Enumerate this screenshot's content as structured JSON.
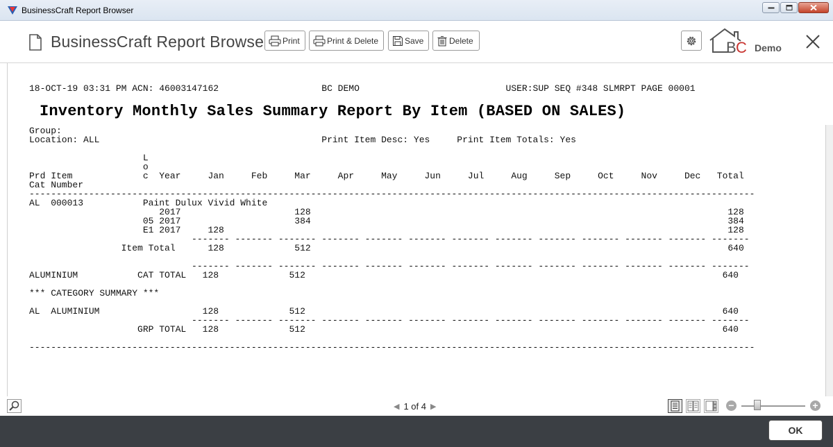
{
  "window": {
    "title": "BusinessCraft Report Browser"
  },
  "header": {
    "title": "BusinessCraft Report Browser",
    "buttons": {
      "print": "Print",
      "print_delete": "Print & Delete",
      "save": "Save",
      "delete": "Delete"
    },
    "logo_text": "BC",
    "demo_label": "Demo"
  },
  "report": {
    "header_line": "18-OCT-19 03:31 PM ACN: 46003147162                   BC DEMO                           USER:SUP SEQ #348 SLMRPT PAGE 00001",
    "title": "Inventory Monthly Sales Summary Report By Item (BASED ON SALES)",
    "lines": [
      "Group:",
      "Location: ALL                                         Print Item Desc: Yes     Print Item Totals: Yes",
      "",
      "                     L",
      "                     o",
      "Prd Item             c  Year     Jan     Feb     Mar     Apr     May     Jun     Jul     Aug     Sep     Oct     Nov     Dec   Total",
      "Cat Number",
      "--------------------------------------------------------------------------------------------------------------------------------------",
      "AL  000013           Paint Dulux Vivid White",
      "                        2017                     128                                                                             128",
      "                     05 2017                     384                                                                             384",
      "                     E1 2017     128                                                                                             128",
      "                              ------- ------- ------- ------- ------- ------- ------- ------- ------- ------- ------- ------- -------",
      "                 Item Total      128             512                                                                             640",
      "",
      "                              ------- ------- ------- ------- ------- ------- ------- ------- ------- ------- ------- ------- -------",
      "ALUMINIUM           CAT TOTAL   128             512                                                                             640",
      "",
      "*** CATEGORY SUMMARY ***",
      "",
      "AL  ALUMINIUM                   128             512                                                                             640",
      "                              ------- ------- ------- ------- ------- ------- ------- ------- ------- ------- ------- ------- -------",
      "                    GRP TOTAL   128             512                                                                             640",
      "",
      "--------------------------------------------------------------------------------------------------------------------------------------"
    ]
  },
  "pager": {
    "text": "1 of 4"
  },
  "footer": {
    "ok_label": "OK"
  }
}
